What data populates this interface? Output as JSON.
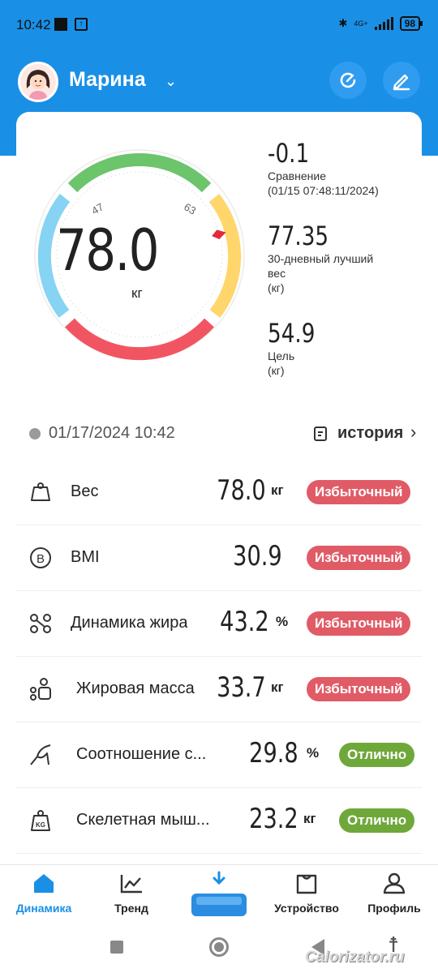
{
  "status_bar": {
    "time": "10:42",
    "battery": "98",
    "network": "4G+"
  },
  "header": {
    "user_name": "Марина"
  },
  "gauge": {
    "value": "78.0",
    "unit": "кг",
    "tick_left": "47",
    "tick_right": "63",
    "level": 0.78
  },
  "stats": [
    {
      "value": "-0.1",
      "label": "Сравнение",
      "sub": "(01/15 07:48:11/2024)"
    },
    {
      "value": "77.35",
      "label": "30-дневный лучший вес",
      "sub": "(кг)"
    },
    {
      "value": "54.9",
      "label": "Цель",
      "sub": "(кг)"
    }
  ],
  "date_row": {
    "datetime": "01/17/2024 10:42",
    "history_label": "история"
  },
  "metrics": [
    {
      "name": "Вес",
      "value": "78.0",
      "unit": "кг",
      "status": "Избыточный",
      "kind": "over",
      "icon": "weight-icon"
    },
    {
      "name": "BMI",
      "value": "30.9",
      "unit": "",
      "status": "Избыточный",
      "kind": "over",
      "icon": "bmi-icon"
    },
    {
      "name": "Динамика жира",
      "value": "43.2",
      "unit": "%",
      "status": "Избыточный",
      "kind": "over",
      "icon": "fat-dynamics-icon"
    },
    {
      "name": "Жировая масса",
      "value": "33.7",
      "unit": "кг",
      "status": "Избыточный",
      "kind": "over",
      "icon": "fat-mass-icon"
    },
    {
      "name": "Соотношение с...",
      "value": "29.8",
      "unit": "%",
      "status": "Отлично",
      "kind": "good",
      "icon": "muscle-ratio-icon"
    },
    {
      "name": "Скелетная мыш...",
      "value": "23.2",
      "unit": "кг",
      "status": "Отлично",
      "kind": "good",
      "icon": "skeletal-muscle-icon"
    }
  ],
  "nav": {
    "items": [
      {
        "label": "Динамика",
        "icon": "home-icon"
      },
      {
        "label": "Тренд",
        "icon": "trend-icon"
      },
      {
        "label": "Устройство",
        "icon": "device-icon"
      },
      {
        "label": "Профиль",
        "icon": "profile-icon"
      }
    ]
  },
  "watermark": "Calorizator.ru",
  "colors": {
    "brand": "#1a8fe6",
    "over": "#e05b66",
    "good": "#6fa83a"
  }
}
